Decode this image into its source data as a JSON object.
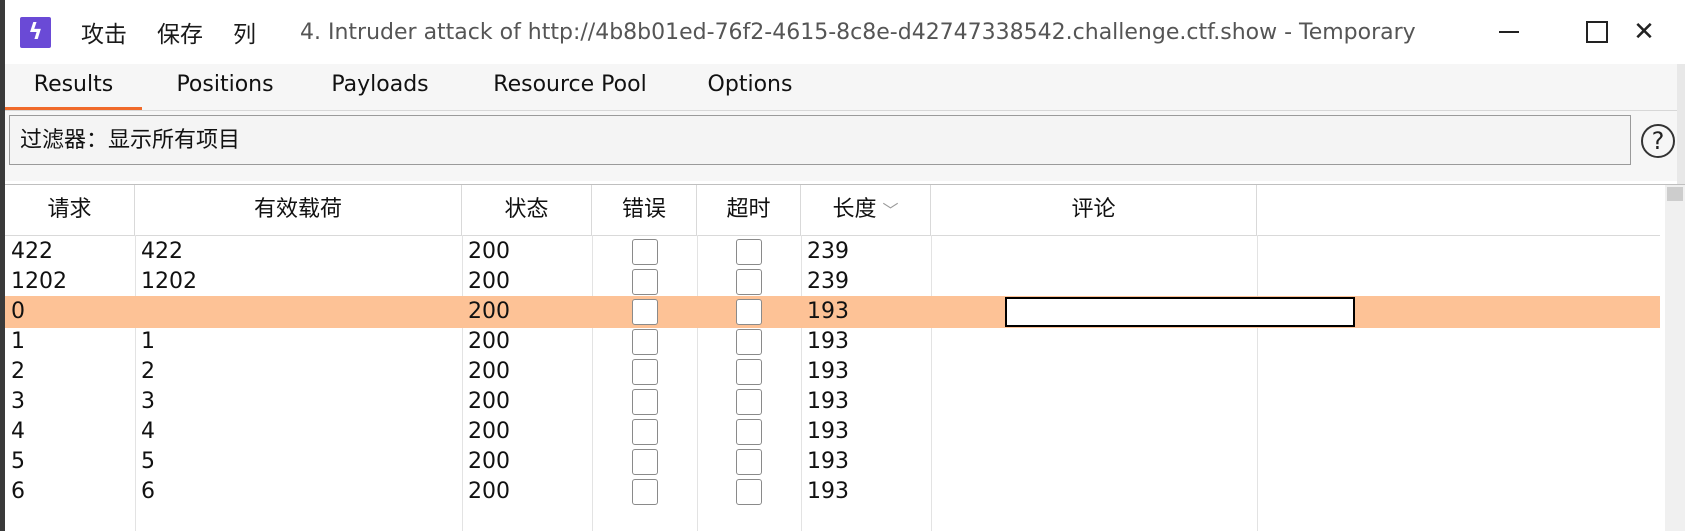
{
  "titlebar": {
    "app_icon": "burp-lightning-icon",
    "menu": [
      "攻击",
      "保存",
      "列"
    ],
    "title": "4. Intruder attack of http://4b8b01ed-76f2-4615-8c8e-d42747338542.challenge.ctf.show - Temporary ...",
    "close_glyph": "✕",
    "help_glyph": "?"
  },
  "tabs": [
    "Results",
    "Positions",
    "Payloads",
    "Resource Pool",
    "Options"
  ],
  "active_tab": "Results",
  "filter": {
    "label": "过滤器：显示所有项目"
  },
  "table": {
    "columns": [
      "请求",
      "有效载荷",
      "状态",
      "错误",
      "超时",
      "长度",
      "评论"
    ],
    "sort_column": "长度",
    "sort_indicator": "chevron-down-icon",
    "rows": [
      {
        "request": "422",
        "payload": "422",
        "status": "200",
        "length": "239",
        "selected": false
      },
      {
        "request": "1202",
        "payload": "1202",
        "status": "200",
        "length": "239",
        "selected": false
      },
      {
        "request": "0",
        "payload": "",
        "status": "200",
        "length": "193",
        "selected": true
      },
      {
        "request": "1",
        "payload": "1",
        "status": "200",
        "length": "193",
        "selected": false
      },
      {
        "request": "2",
        "payload": "2",
        "status": "200",
        "length": "193",
        "selected": false
      },
      {
        "request": "3",
        "payload": "3",
        "status": "200",
        "length": "193",
        "selected": false
      },
      {
        "request": "4",
        "payload": "4",
        "status": "200",
        "length": "193",
        "selected": false
      },
      {
        "request": "5",
        "payload": "5",
        "status": "200",
        "length": "193",
        "selected": false
      },
      {
        "request": "6",
        "payload": "6",
        "status": "200",
        "length": "193",
        "selected": false
      }
    ]
  },
  "colors": {
    "accent": "#f06a2a",
    "selected_row": "#fdc296",
    "app_icon": "#6a4ad6"
  }
}
